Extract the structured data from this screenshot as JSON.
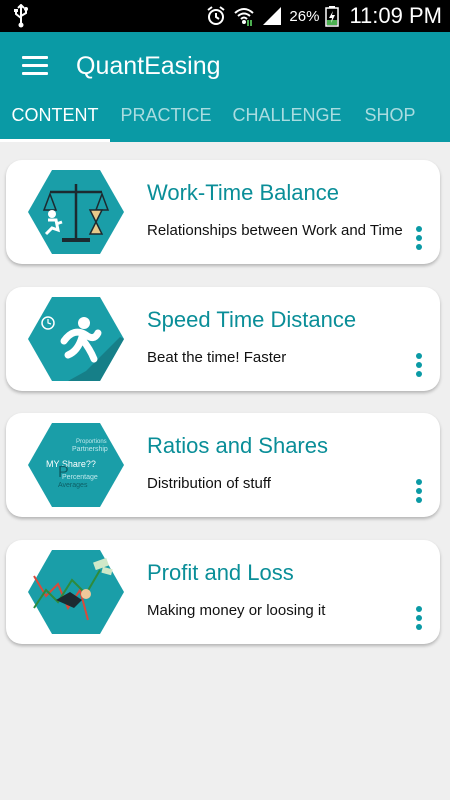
{
  "status_bar": {
    "battery_percent": "26%",
    "time": "11:09 PM"
  },
  "app_bar": {
    "title": "QuantEasing"
  },
  "tabs": [
    {
      "label": "CONTENT",
      "active": true
    },
    {
      "label": "PRACTICE",
      "active": false
    },
    {
      "label": "CHALLENGE",
      "active": false
    },
    {
      "label": "SHOP",
      "active": false
    }
  ],
  "topics": [
    {
      "title": "Work-Time Balance",
      "subtitle": "Relationships between Work and Time",
      "icon": "scales-hourglass-runner-icon"
    },
    {
      "title": "Speed Time Distance",
      "subtitle": "Beat the time! Faster",
      "icon": "running-person-icon"
    },
    {
      "title": "Ratios and Shares",
      "subtitle": "Distribution of stuff",
      "icon": "word-cloud-icon"
    },
    {
      "title": "Profit and Loss",
      "subtitle": "Making money or loosing it",
      "icon": "profit-chart-icon"
    }
  ],
  "thumb_word_cloud": [
    "MY Share??",
    "Partnership",
    "Proportions",
    "Averages",
    "Percentage"
  ],
  "colors": {
    "primary": "#0a9aa5",
    "title_text": "#0a8e98",
    "background": "#efefef"
  }
}
